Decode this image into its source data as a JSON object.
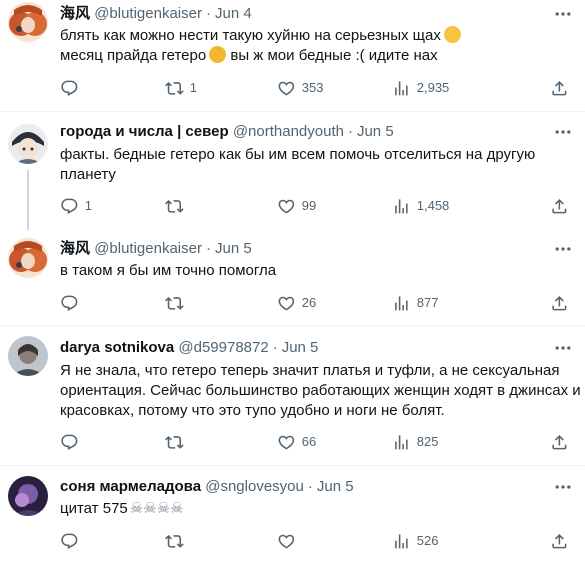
{
  "tweets": [
    {
      "name": "海风",
      "handle": "@blutigenkaiser",
      "date": "Jun 4",
      "lines": [
        "блять как можно нести такую хуйню на серьезных щах",
        "месяц прайда гетеро",
        "вы ж мои бедные :( идите нах"
      ],
      "emoji": [
        "loudly-crying-face",
        "pleading-face"
      ],
      "replies": "",
      "retweets": "1",
      "likes": "353",
      "views": "2,935"
    },
    {
      "name": "города и числа | север",
      "handle": "@northandyouth",
      "date": "Jun 5",
      "lines": [
        "факты. бедные гетеро как бы им всем помочь отселиться на другую",
        "планету"
      ],
      "replies": "1",
      "retweets": "",
      "likes": "99",
      "views": "1,458"
    },
    {
      "name": "海风",
      "handle": "@blutigenkaiser",
      "date": "Jun 5",
      "lines": [
        "в таком я бы им точно помогла"
      ],
      "replies": "",
      "retweets": "",
      "likes": "26",
      "views": "877"
    },
    {
      "name": "darya sotnikova",
      "handle": "@d59978872",
      "date": "Jun 5",
      "lines": [
        "Я не знала, что гетеро теперь значит платья и туфли, а не сексуальная",
        "ориентация. Сейчас большинство работающих женщин ходят в джинсах и",
        "красовках, потому что это тупо удобно и ноги не болят."
      ],
      "replies": "",
      "retweets": "",
      "likes": "66",
      "views": "825"
    },
    {
      "name": "соня мармеладова",
      "handle": "@snglovesyou",
      "date": "Jun 5",
      "lines": [
        "цитат 575"
      ],
      "emoji": [
        "skull-and-crossbones",
        "skull-and-crossbones",
        "skull-and-crossbones",
        "skull-and-crossbones"
      ],
      "replies": "",
      "retweets": "",
      "likes": "",
      "views": "526"
    }
  ],
  "colors": {
    "text": "#0f1419",
    "secondary": "#536471",
    "divider": "#eff3f4",
    "thread": "#cfd9de"
  },
  "icons": [
    "more-icon",
    "reply-icon",
    "retweet-icon",
    "like-icon",
    "views-icon",
    "share-icon"
  ]
}
